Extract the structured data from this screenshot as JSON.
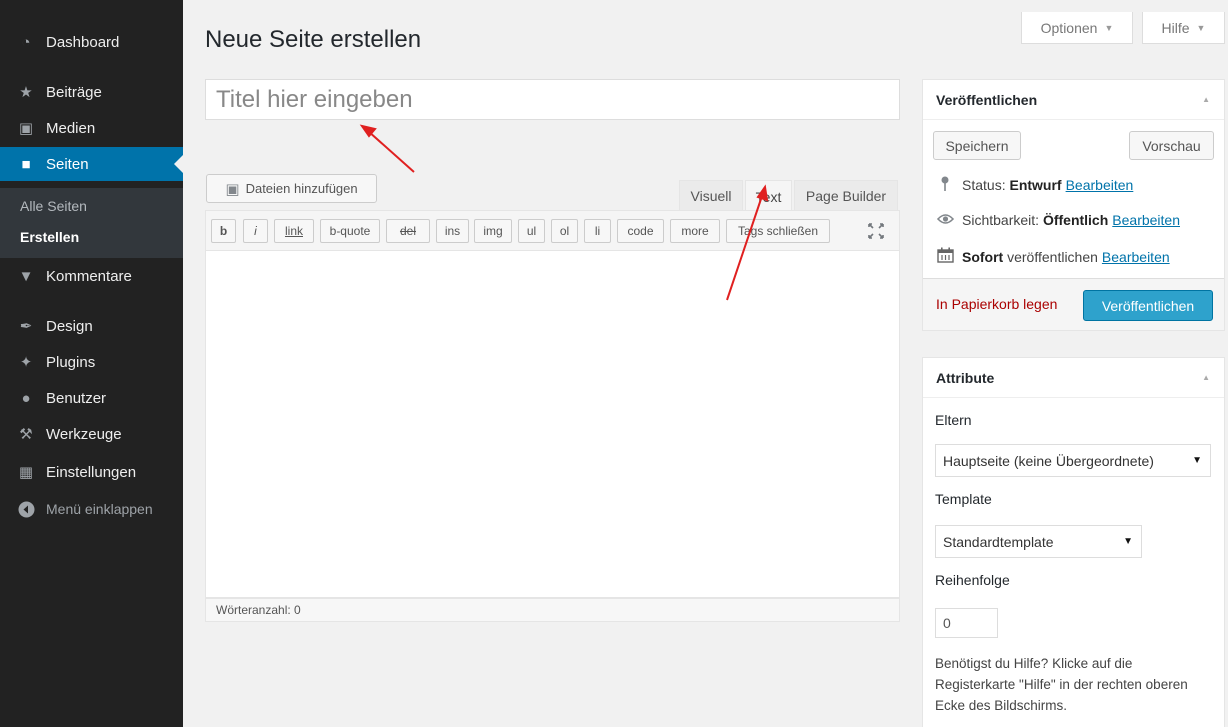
{
  "sidebar": {
    "items": [
      {
        "label": "Dashboard",
        "icon": "dashboard-icon",
        "glyph": "◔"
      },
      {
        "label": "Beiträge",
        "icon": "pushpin-icon",
        "glyph": "★"
      },
      {
        "label": "Medien",
        "icon": "media-icon",
        "glyph": "▣"
      },
      {
        "label": "Seiten",
        "icon": "pages-icon",
        "glyph": "■"
      },
      {
        "label": "Kommentare",
        "icon": "comment-icon",
        "glyph": "▼"
      },
      {
        "label": "Design",
        "icon": "brush-icon",
        "glyph": "✒"
      },
      {
        "label": "Plugins",
        "icon": "plugin-icon",
        "glyph": "✦"
      },
      {
        "label": "Benutzer",
        "icon": "user-icon",
        "glyph": "●"
      },
      {
        "label": "Werkzeuge",
        "icon": "wrench-icon",
        "glyph": "⚒"
      },
      {
        "label": "Einstellungen",
        "icon": "settings-icon",
        "glyph": "▦"
      }
    ],
    "submenu": [
      "Alle Seiten",
      "Erstellen"
    ],
    "collapse_label": "Menü einklappen",
    "active_color": "#0073aa"
  },
  "screen_options": {
    "options_label": "Optionen",
    "help_label": "Hilfe"
  },
  "page_title": "Neue Seite erstellen",
  "title_input": {
    "placeholder": "Titel hier eingeben",
    "value": ""
  },
  "editor": {
    "add_media_label": "Dateien hinzufügen",
    "tabs": [
      "Visuell",
      "Text",
      "Page Builder"
    ],
    "active_tab": "Text",
    "quicktags": [
      "b",
      "i",
      "link",
      "b-quote",
      "del",
      "ins",
      "img",
      "ul",
      "ol",
      "li",
      "code",
      "more",
      "Tags schließen"
    ],
    "word_count": "Wörteranzahl: 0"
  },
  "publish_box": {
    "title": "Veröffentlichen",
    "save_label": "Speichern",
    "preview_label": "Vorschau",
    "status_label": "Status:",
    "status_value": "Entwurf",
    "visibility_label": "Sichtbarkeit:",
    "visibility_value": "Öffentlich",
    "schedule_strong": "Sofort",
    "schedule_rest": "veröffentlichen",
    "edit_link": "Bearbeiten",
    "trash_label": "In Papierkorb legen",
    "publish_label": "Veröffentlichen",
    "publish_color": "#2ea2cc"
  },
  "attributes_box": {
    "title": "Attribute",
    "parent_label": "Eltern",
    "parent_value": "Hauptseite (keine Übergeordnete)",
    "template_label": "Template",
    "template_value": "Standardtemplate",
    "order_label": "Reihenfolge",
    "order_value": "0",
    "help_text": "Benötigst du Hilfe? Klicke auf die Registerkarte \"Hilfe\" in der rechten oberen Ecke des Bildschirms."
  }
}
